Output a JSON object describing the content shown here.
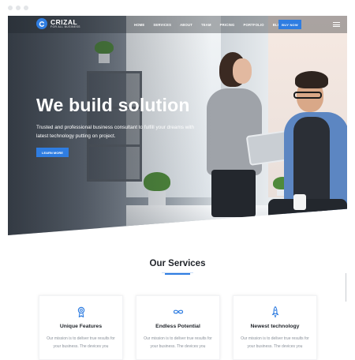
{
  "brand": {
    "name": "CRIZAL",
    "tagline": "FOR ALL BUSINESS",
    "accent": "#2f7de1"
  },
  "nav": {
    "items": [
      {
        "label": "HOME"
      },
      {
        "label": "SERVICES"
      },
      {
        "label": "ABOUT"
      },
      {
        "label": "TEAM"
      },
      {
        "label": "PRICING"
      },
      {
        "label": "PORTFOLIO"
      },
      {
        "label": "BLOG"
      }
    ],
    "cta": "BUY NOW",
    "menu_icon": "hamburger-icon"
  },
  "hero": {
    "title": "We build solution",
    "description": "Trusted and professional business consultant to fulfill your dreams with latest technology putting on project.",
    "button": "LEARN MORE"
  },
  "services": {
    "title": "Our Services",
    "cards": [
      {
        "icon": "award-ribbon-icon",
        "title": "Unique Features",
        "text": "Our mission is to deliver true results for your business. The devices you"
      },
      {
        "icon": "infinity-icon",
        "title": "Endless Potential",
        "text": "Our mission is to deliver true results for your business. The devices you"
      },
      {
        "icon": "rocket-icon",
        "title": "Newest technology",
        "text": "Our mission is to deliver true results for your business. The devices you"
      }
    ]
  }
}
